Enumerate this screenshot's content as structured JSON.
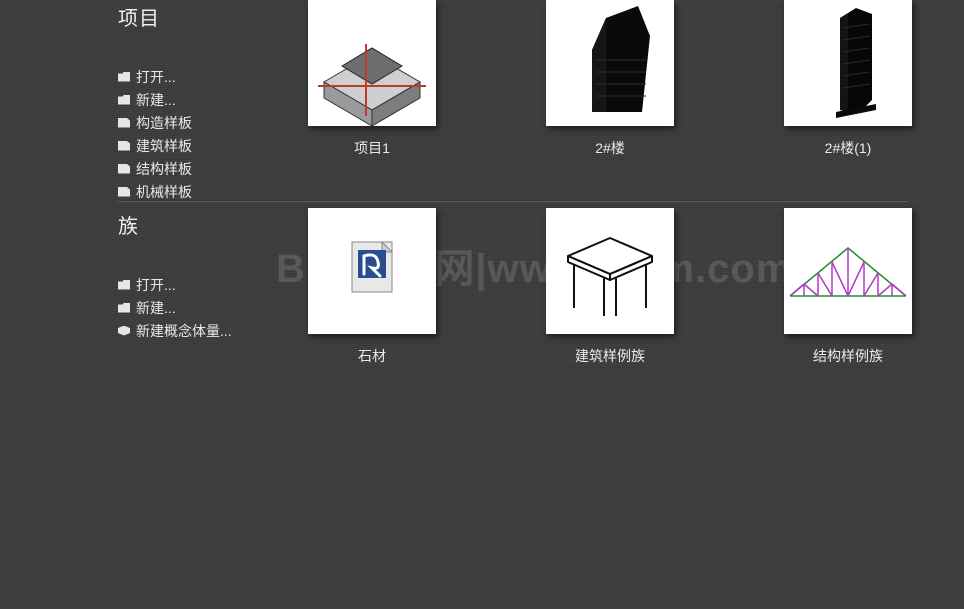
{
  "watermark": "BIM教程网|www.ifbim.com",
  "sections": {
    "projects": {
      "title": "项目",
      "links": [
        {
          "label": "打开...",
          "icon": "folder"
        },
        {
          "label": "新建...",
          "icon": "folder"
        },
        {
          "label": "构造样板",
          "icon": "doc"
        },
        {
          "label": "建筑样板",
          "icon": "doc"
        },
        {
          "label": "结构样板",
          "icon": "doc"
        },
        {
          "label": "机械样板",
          "icon": "doc"
        }
      ],
      "cards": [
        {
          "label": "项目1",
          "thumb": "house"
        },
        {
          "label": "2#楼",
          "thumb": "cityblock"
        },
        {
          "label": "2#楼(1)",
          "thumb": "tower"
        }
      ]
    },
    "families": {
      "title": "族",
      "links": [
        {
          "label": "打开...",
          "icon": "folder"
        },
        {
          "label": "新建...",
          "icon": "folder"
        },
        {
          "label": "新建概念体量...",
          "icon": "cube"
        }
      ],
      "cards": [
        {
          "label": "石材",
          "thumb": "revit"
        },
        {
          "label": "建筑样例族",
          "thumb": "table"
        },
        {
          "label": "结构样例族",
          "thumb": "truss"
        }
      ]
    }
  }
}
